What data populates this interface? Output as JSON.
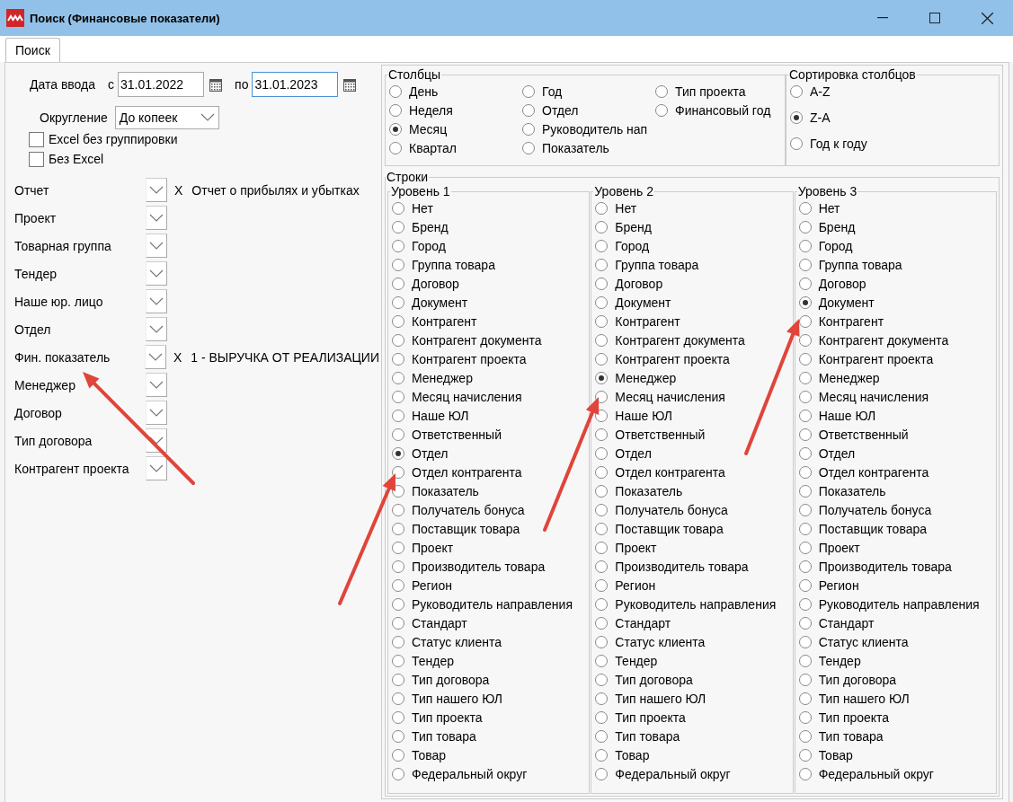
{
  "window": {
    "title": "Поиск (Финансовые показатели)"
  },
  "tabs": [
    {
      "label": "Поиск",
      "selected": true
    }
  ],
  "date_entry": {
    "label": "Дата ввода",
    "from_label": "с",
    "from": {
      "value": "31.01.2022",
      "focused": false
    },
    "to_label": "по",
    "to": {
      "value": "31.01.2023",
      "focused": true
    }
  },
  "rounding": {
    "label": "Округление",
    "value": "До копеек"
  },
  "checkboxes": [
    {
      "label": "Excel без группировки",
      "checked": false
    },
    {
      "label": "Без Excel",
      "checked": false
    }
  ],
  "filters": [
    {
      "label": "Отчет",
      "clear": "X",
      "value": "Отчет о прибылях и убытках"
    },
    {
      "label": "Проект"
    },
    {
      "label": "Товарная группа"
    },
    {
      "label": "Тендер"
    },
    {
      "label": "Наше юр. лицо"
    },
    {
      "label": "Отдел"
    },
    {
      "label": "Фин. показатель",
      "clear": "X",
      "value": "1 - ВЫРУЧКА ОТ РЕАЛИЗАЦИИ"
    },
    {
      "label": "Менеджер"
    },
    {
      "label": "Договор"
    },
    {
      "label": "Тип договора"
    },
    {
      "label": "Контрагент проекта"
    }
  ],
  "columns": {
    "title": "Столбцы",
    "options": [
      {
        "label": "День",
        "selected": false
      },
      {
        "label": "Неделя",
        "selected": false
      },
      {
        "label": "Месяц",
        "selected": true
      },
      {
        "label": "Квартал",
        "selected": false
      },
      {
        "label": "Год",
        "selected": false
      },
      {
        "label": "Отдел",
        "selected": false
      },
      {
        "label": "Руководитель нап",
        "selected": false
      },
      {
        "label": "Показатель",
        "selected": false
      },
      {
        "label": "Тип проекта",
        "selected": false
      },
      {
        "label": "Финансовый год",
        "selected": false
      }
    ]
  },
  "column_sort": {
    "title": "Сортировка столбцов",
    "options": [
      {
        "label": "A-Z",
        "selected": false
      },
      {
        "label": "Z-A",
        "selected": true
      },
      {
        "label": "Год к году",
        "selected": false
      }
    ]
  },
  "rows": {
    "title": "Строки",
    "levels": [
      {
        "title": "Уровень 1",
        "options": [
          {
            "label": "Нет",
            "selected": false
          },
          {
            "label": "Бренд",
            "selected": false
          },
          {
            "label": "Город",
            "selected": false
          },
          {
            "label": "Группа товара",
            "selected": false
          },
          {
            "label": "Договор",
            "selected": false
          },
          {
            "label": "Документ",
            "selected": false
          },
          {
            "label": "Контрагент",
            "selected": false
          },
          {
            "label": "Контрагент документа",
            "selected": false
          },
          {
            "label": "Контрагент проекта",
            "selected": false
          },
          {
            "label": "Менеджер",
            "selected": false
          },
          {
            "label": "Месяц начисления",
            "selected": false
          },
          {
            "label": "Наше ЮЛ",
            "selected": false
          },
          {
            "label": "Ответственный",
            "selected": false
          },
          {
            "label": "Отдел",
            "selected": true
          },
          {
            "label": "Отдел контрагента",
            "selected": false
          },
          {
            "label": "Показатель",
            "selected": false
          },
          {
            "label": "Получатель бонуса",
            "selected": false
          },
          {
            "label": "Поставщик товара",
            "selected": false
          },
          {
            "label": "Проект",
            "selected": false
          },
          {
            "label": "Производитель товара",
            "selected": false
          },
          {
            "label": "Регион",
            "selected": false
          },
          {
            "label": "Руководитель направления",
            "selected": false
          },
          {
            "label": "Стандарт",
            "selected": false
          },
          {
            "label": "Статус клиента",
            "selected": false
          },
          {
            "label": "Тендер",
            "selected": false
          },
          {
            "label": "Тип договора",
            "selected": false
          },
          {
            "label": "Тип нашего ЮЛ",
            "selected": false
          },
          {
            "label": "Тип проекта",
            "selected": false
          },
          {
            "label": "Тип товара",
            "selected": false
          },
          {
            "label": "Товар",
            "selected": false
          },
          {
            "label": "Федеральный округ",
            "selected": false
          }
        ]
      },
      {
        "title": "Уровень 2",
        "options": [
          {
            "label": "Нет",
            "selected": false
          },
          {
            "label": "Бренд",
            "selected": false
          },
          {
            "label": "Город",
            "selected": false
          },
          {
            "label": "Группа товара",
            "selected": false
          },
          {
            "label": "Договор",
            "selected": false
          },
          {
            "label": "Документ",
            "selected": false
          },
          {
            "label": "Контрагент",
            "selected": false
          },
          {
            "label": "Контрагент документа",
            "selected": false
          },
          {
            "label": "Контрагент проекта",
            "selected": false
          },
          {
            "label": "Менеджер",
            "selected": true
          },
          {
            "label": "Месяц начисления",
            "selected": false
          },
          {
            "label": "Наше ЮЛ",
            "selected": false
          },
          {
            "label": "Ответственный",
            "selected": false
          },
          {
            "label": "Отдел",
            "selected": false
          },
          {
            "label": "Отдел контрагента",
            "selected": false
          },
          {
            "label": "Показатель",
            "selected": false
          },
          {
            "label": "Получатель бонуса",
            "selected": false
          },
          {
            "label": "Поставщик товара",
            "selected": false
          },
          {
            "label": "Проект",
            "selected": false
          },
          {
            "label": "Производитель товара",
            "selected": false
          },
          {
            "label": "Регион",
            "selected": false
          },
          {
            "label": "Руководитель направления",
            "selected": false
          },
          {
            "label": "Стандарт",
            "selected": false
          },
          {
            "label": "Статус клиента",
            "selected": false
          },
          {
            "label": "Тендер",
            "selected": false
          },
          {
            "label": "Тип договора",
            "selected": false
          },
          {
            "label": "Тип нашего ЮЛ",
            "selected": false
          },
          {
            "label": "Тип проекта",
            "selected": false
          },
          {
            "label": "Тип товара",
            "selected": false
          },
          {
            "label": "Товар",
            "selected": false
          },
          {
            "label": "Федеральный округ",
            "selected": false
          }
        ]
      },
      {
        "title": "Уровень 3",
        "options": [
          {
            "label": "Нет",
            "selected": false
          },
          {
            "label": "Бренд",
            "selected": false
          },
          {
            "label": "Город",
            "selected": false
          },
          {
            "label": "Группа товара",
            "selected": false
          },
          {
            "label": "Договор",
            "selected": false
          },
          {
            "label": "Документ",
            "selected": true
          },
          {
            "label": "Контрагент",
            "selected": false
          },
          {
            "label": "Контрагент документа",
            "selected": false
          },
          {
            "label": "Контрагент проекта",
            "selected": false
          },
          {
            "label": "Менеджер",
            "selected": false
          },
          {
            "label": "Месяц начисления",
            "selected": false
          },
          {
            "label": "Наше ЮЛ",
            "selected": false
          },
          {
            "label": "Ответственный",
            "selected": false
          },
          {
            "label": "Отдел",
            "selected": false
          },
          {
            "label": "Отдел контрагента",
            "selected": false
          },
          {
            "label": "Показатель",
            "selected": false
          },
          {
            "label": "Получатель бонуса",
            "selected": false
          },
          {
            "label": "Поставщик товара",
            "selected": false
          },
          {
            "label": "Проект",
            "selected": false
          },
          {
            "label": "Производитель товара",
            "selected": false
          },
          {
            "label": "Регион",
            "selected": false
          },
          {
            "label": "Руководитель направления",
            "selected": false
          },
          {
            "label": "Стандарт",
            "selected": false
          },
          {
            "label": "Статус клиента",
            "selected": false
          },
          {
            "label": "Тендер",
            "selected": false
          },
          {
            "label": "Тип договора",
            "selected": false
          },
          {
            "label": "Тип нашего ЮЛ",
            "selected": false
          },
          {
            "label": "Тип проекта",
            "selected": false
          },
          {
            "label": "Тип товара",
            "selected": false
          },
          {
            "label": "Товар",
            "selected": false
          },
          {
            "label": "Федеральный округ",
            "selected": false
          }
        ]
      }
    ]
  }
}
